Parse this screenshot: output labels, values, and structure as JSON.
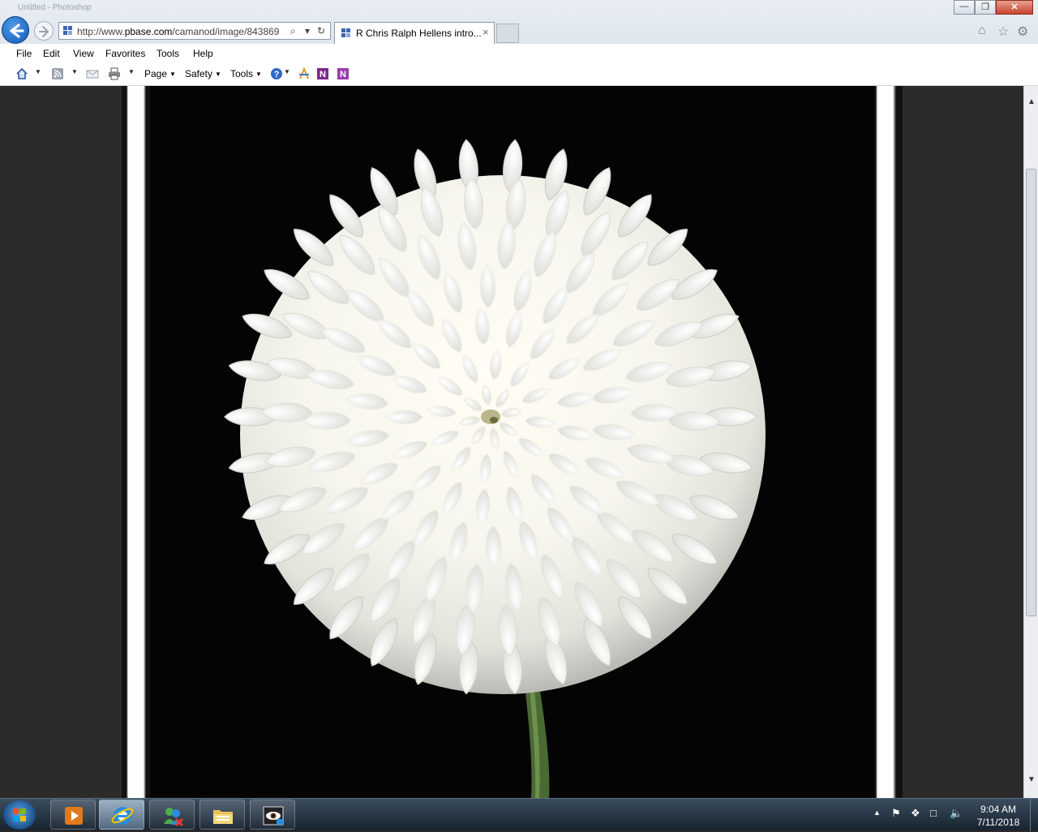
{
  "window": {
    "ghost_title": "Untitled - Photoshop",
    "controls": {
      "minimize": "—",
      "maximize": "❐",
      "close": "✕"
    }
  },
  "address_bar": {
    "url_prefix": "http://www.",
    "url_domain": "pbase.com",
    "url_rest": "/camanod/image/843869",
    "search_icon": "⌕",
    "dropdown_icon": "▾",
    "refresh_icon": "↻"
  },
  "tabs": [
    {
      "label": "R Chris Ralph Hellens intro...",
      "close": "×"
    }
  ],
  "menu": [
    "File",
    "Edit",
    "View",
    "Favorites",
    "Tools",
    "Help"
  ],
  "command_bar": {
    "page": "Page",
    "safety": "Safety",
    "tools": "Tools",
    "help": "?"
  },
  "taskbar": {
    "clock_time": "9:04 AM",
    "clock_date": "7/11/2018",
    "tray_up": "▲"
  },
  "colors": {
    "ie_blue": "#1458b5",
    "photo_background": "#040404",
    "page_background": "#2b2b2b"
  },
  "icons": [
    "home-icon",
    "rss-icon",
    "mail-icon",
    "print-icon",
    "help-icon",
    "onenote-icon",
    "star-icon",
    "gear-icon"
  ]
}
